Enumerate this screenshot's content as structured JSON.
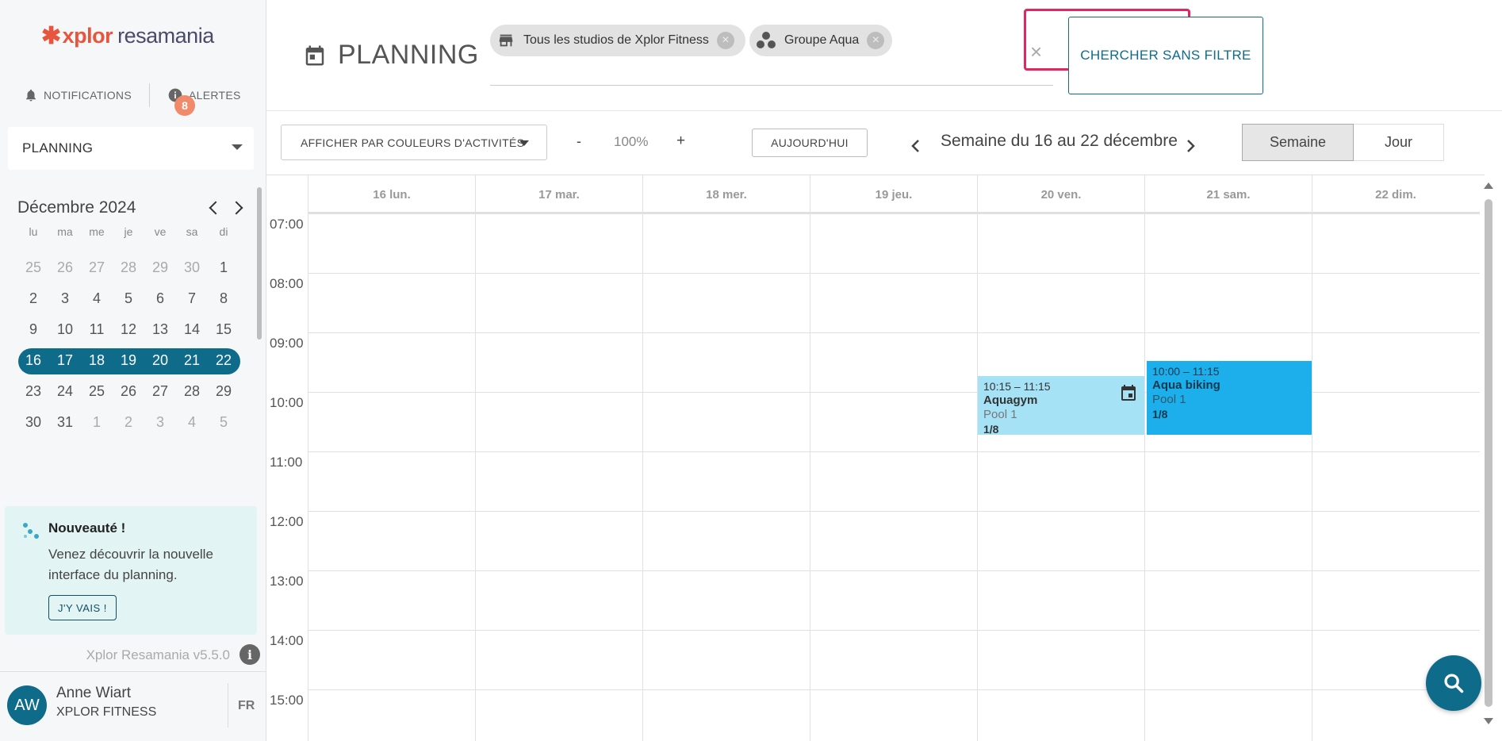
{
  "brand": {
    "mark": "✱",
    "name_a": "xplor",
    "name_b": "resamania"
  },
  "sidebar": {
    "notifications_label": "NOTIFICATIONS",
    "alerts_label": "ALERTES",
    "alerts_count": "8",
    "module_select": "PLANNING",
    "mini_calendar": {
      "month": "Décembre 2024",
      "weekdays": [
        "lu",
        "ma",
        "me",
        "je",
        "ve",
        "sa",
        "di"
      ],
      "weeks": [
        [
          "25",
          "26",
          "27",
          "28",
          "29",
          "30",
          "1"
        ],
        [
          "2",
          "3",
          "4",
          "5",
          "6",
          "7",
          "8"
        ],
        [
          "9",
          "10",
          "11",
          "12",
          "13",
          "14",
          "15"
        ],
        [
          "16",
          "17",
          "18",
          "19",
          "20",
          "21",
          "22"
        ],
        [
          "23",
          "24",
          "25",
          "26",
          "27",
          "28",
          "29"
        ],
        [
          "30",
          "31",
          "1",
          "2",
          "3",
          "4",
          "5"
        ]
      ]
    },
    "news": {
      "title": "Nouveauté !",
      "text": "Venez découvrir la nouvelle interface du planning.",
      "button": "J'Y VAIS !"
    },
    "version": "Xplor Resamania v5.5.0",
    "user": {
      "initials": "AW",
      "name": "Anne Wiart",
      "org": "XPLOR FITNESS",
      "lang": "FR"
    }
  },
  "header": {
    "title": "PLANNING",
    "filters": [
      {
        "label": "Tous les studios de Xplor Fitness",
        "icon": "store-icon"
      },
      {
        "label": "Groupe Aqua",
        "icon": "group-icon"
      }
    ],
    "clear_symbol": "×",
    "search_button": "CHERCHER SANS FILTRE"
  },
  "toolbar": {
    "color_select": "AFFICHER PAR COULEURS D'ACTIVITÉS",
    "zoom_minus": "-",
    "zoom_value": "100%",
    "zoom_plus": "+",
    "today_button": "AUJOURD'HUI",
    "week_label": "Semaine du 16 au 22 décembre",
    "view_week": "Semaine",
    "view_day": "Jour"
  },
  "calendar": {
    "days": [
      "16 lun.",
      "17 mar.",
      "18 mer.",
      "19 jeu.",
      "20 ven.",
      "21 sam.",
      "22 dim."
    ],
    "hours": [
      "07:00",
      "08:00",
      "09:00",
      "10:00",
      "11:00",
      "12:00",
      "13:00",
      "14:00",
      "15:00"
    ],
    "events": [
      {
        "time": "10:15 – 11:15",
        "name": "Aquagym",
        "room": "Pool 1",
        "count": "1/8",
        "color": "#a6e2f6"
      },
      {
        "time": "10:00 – 11:15",
        "name": "Aqua biking",
        "room": "Pool 1",
        "count": "1/8",
        "color": "#1daeec"
      }
    ]
  },
  "colors": {
    "primary": "#0f6b8a",
    "brand": "#e8553f",
    "highlight": "#e6245e"
  }
}
